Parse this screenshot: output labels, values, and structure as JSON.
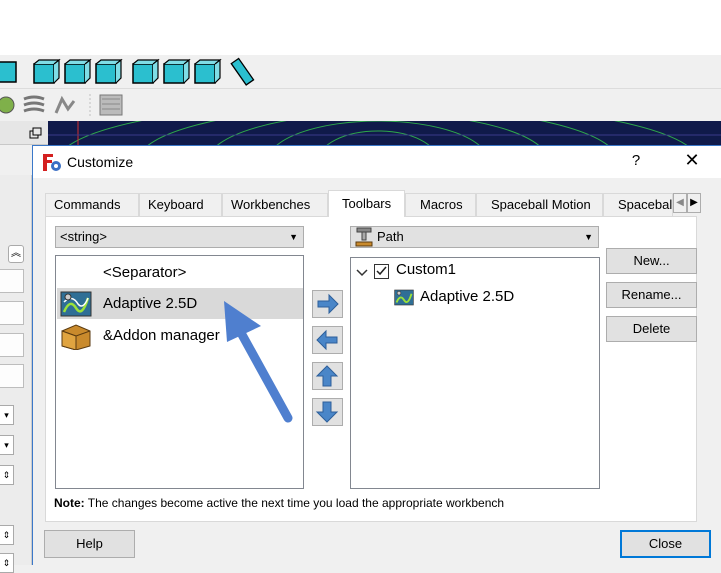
{
  "dialog": {
    "title": "Customize",
    "help_glyph": "?",
    "close_glyph": "✕"
  },
  "tabs": [
    {
      "label": "Commands"
    },
    {
      "label": "Keyboard"
    },
    {
      "label": "Workbenches"
    },
    {
      "label": "Toolbars",
      "active": true
    },
    {
      "label": "Macros"
    },
    {
      "label": "Spaceball Motion"
    },
    {
      "label": "Spaceball"
    }
  ],
  "left_combo": {
    "value": "<string>"
  },
  "commands": [
    {
      "label": "<Separator>",
      "icon": "none"
    },
    {
      "label": "Adaptive 2.5D",
      "icon": "adaptive-icon",
      "selected": true
    },
    {
      "label": "&Addon manager",
      "icon": "addon-box-icon"
    }
  ],
  "right_combo": {
    "value": "Path",
    "icon": "path-workbench-icon"
  },
  "toolbar_tree": {
    "toolbar": {
      "label": "Custom1",
      "checked": true
    },
    "children": [
      {
        "label": "Adaptive 2.5D",
        "icon": "adaptive-icon"
      }
    ]
  },
  "arrow_buttons": [
    "arrow-right-icon",
    "arrow-left-icon",
    "arrow-up-icon",
    "arrow-down-icon"
  ],
  "side_buttons": {
    "new": "New...",
    "rename": "Rename...",
    "delete": "Delete"
  },
  "note": {
    "label": "Note:",
    "text": " The changes become active the next time you load the appropriate workbench"
  },
  "footer": {
    "help": "Help",
    "close": "Close"
  },
  "colors": {
    "accent": "#0078d7",
    "arrow_fill": "#4a86c8",
    "annotation_arrow": "#4f7fcf",
    "viewport_bg": "#101a4a",
    "toolbar_icon": "#2bbfcf"
  }
}
